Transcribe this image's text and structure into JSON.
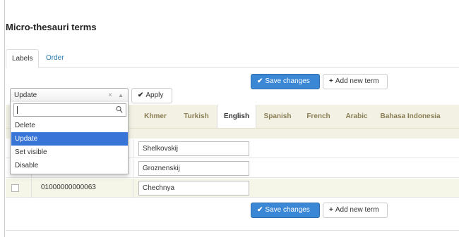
{
  "page": {
    "title": "Micro-thesauri terms"
  },
  "tabs": [
    {
      "label": "Labels",
      "active": true
    },
    {
      "label": "Order",
      "active": false
    }
  ],
  "toolbar": {
    "save_label": "Save changes",
    "add_label": "Add new term",
    "apply_label": "Apply"
  },
  "bulk_action": {
    "selected": "Update",
    "options": [
      "Delete",
      "Update",
      "Set visible",
      "Disable"
    ],
    "search_value": ""
  },
  "languages": [
    "Khmer",
    "Turkish",
    "English",
    "Spanish",
    "French",
    "Arabic",
    "Bahasa Indonesia"
  ],
  "active_language": "English",
  "terms": [
    {
      "code": "",
      "label": "Shelkovskij"
    },
    {
      "code": "",
      "label": "Groznenskij"
    },
    {
      "code": "01000000000063",
      "label": "Chechnya"
    }
  ],
  "colors": {
    "primary": "#3a87d6",
    "selected_option": "#3875d7",
    "header_bg": "#f2f1e4",
    "link": "#2a7ab0"
  },
  "icons": {
    "check": "check-icon",
    "plus": "plus-icon",
    "search": "search-icon"
  }
}
